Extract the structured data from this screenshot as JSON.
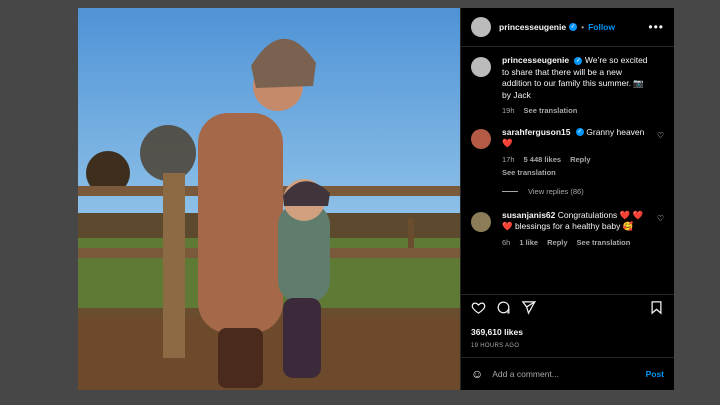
{
  "post": {
    "username": "princesseugenie",
    "follow_label": "Follow",
    "caption": "We’re so excited to share that there will be a new addition to our family this summer. 📷 by Jack",
    "caption_time": "19h",
    "see_translation": "See translation"
  },
  "comments": [
    {
      "username": "sarahferguson15",
      "text": "Granny heaven ❤️",
      "time": "17h",
      "likes": "5 448 likes",
      "reply": "Reply",
      "see_translation": "See translation",
      "view_replies": "View replies (86)"
    },
    {
      "username": "susanjanis62",
      "text": "Congratulations ❤️ ❤️ ❤️ blessings for a healthy baby 🥰",
      "time": "6h",
      "likes": "1 like",
      "reply": "Reply",
      "see_translation": "See translation"
    }
  ],
  "footer": {
    "likes_count": "369,610 likes",
    "time_ago": "19 HOURS AGO",
    "add_comment_placeholder": "Add a comment...",
    "post_label": "Post"
  },
  "icons": {
    "more": "more-icon",
    "like": "heart-icon",
    "comment": "comment-icon",
    "share": "share-icon",
    "save": "bookmark-icon",
    "emoji": "emoji-icon"
  },
  "colors": {
    "background": "#474747",
    "modal": "#000000",
    "accent": "#0095f6",
    "heart": "#ff3040",
    "muted": "#a8a8a8"
  }
}
